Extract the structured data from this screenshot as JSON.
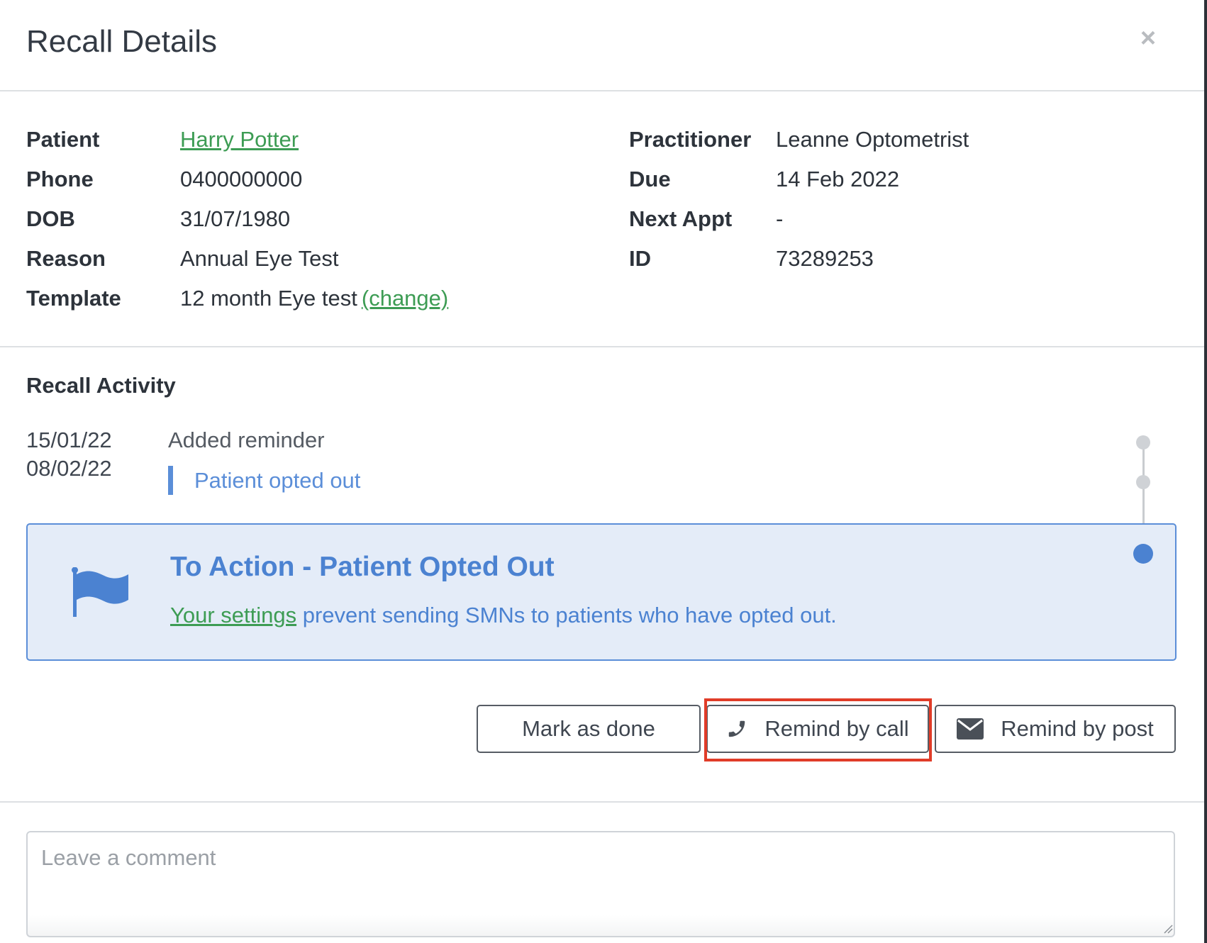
{
  "modal": {
    "title": "Recall Details",
    "close_label": "×"
  },
  "details": {
    "left": [
      {
        "label": "Patient",
        "value": "Harry Potter",
        "is_link": true
      },
      {
        "label": "Phone",
        "value": "0400000000"
      },
      {
        "label": "DOB",
        "value": "31/07/1980"
      },
      {
        "label": "Reason",
        "value": "Annual Eye Test"
      },
      {
        "label": "Template",
        "value": "12 month Eye test",
        "change_link": "(change)"
      }
    ],
    "right": [
      {
        "label": "Practitioner",
        "value": "Leanne Optometrist"
      },
      {
        "label": "Due",
        "value": "14 Feb 2022"
      },
      {
        "label": "Next Appt",
        "value": "-"
      },
      {
        "label": "ID",
        "value": "73289253"
      }
    ]
  },
  "activity": {
    "title": "Recall Activity",
    "dates": [
      "15/01/22",
      "08/02/22"
    ],
    "event": "Added reminder",
    "note": "Patient opted out"
  },
  "action": {
    "title": "To Action - Patient Opted Out",
    "settings_link": "Your settings",
    "desc": " prevent sending SMNs to patients who have opted out.",
    "icon": "flag-icon"
  },
  "buttons": {
    "mark_done": "Mark as done",
    "remind_call": "Remind by call",
    "remind_post": "Remind by post"
  },
  "comment": {
    "placeholder": "Leave a comment",
    "value": ""
  },
  "colors": {
    "accent_blue": "#5b8ed8",
    "link_green": "#3d9c54",
    "highlight_red": "#e03c28"
  }
}
